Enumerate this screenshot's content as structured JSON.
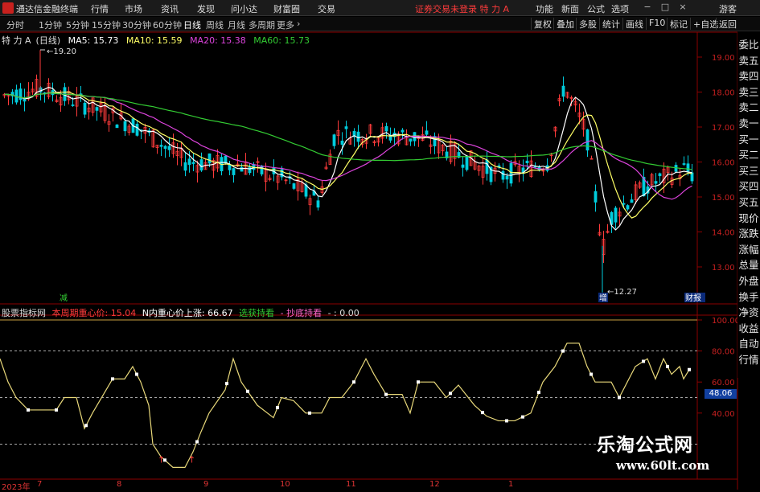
{
  "menubar": {
    "app_title": "通达信金融终端",
    "items": [
      "行情",
      "市场",
      "资讯",
      "发现",
      "问小达",
      "财富圈",
      "交易"
    ],
    "notice": "证券交易未登录  特 力 A",
    "right_items": [
      "功能",
      "新面",
      "公式",
      "选项"
    ],
    "guest": "游客"
  },
  "tabs": {
    "items": [
      "分时",
      "1分钟",
      "5分钟",
      "15分钟",
      "30分钟",
      "60分钟",
      "日线",
      "周线",
      "月线",
      "多周期",
      "更多"
    ],
    "active": "日线",
    "right_buttons": [
      "复权",
      "叠加",
      "多股",
      "统计",
      "画线",
      "F10",
      "标记",
      "+自选",
      "返回"
    ]
  },
  "main_info": {
    "stock": "特 力 A",
    "period": "(日线)",
    "ma5": "MA5: 15.73",
    "ma10": "MA10: 15.59",
    "ma20": "MA20: 15.38",
    "ma60": "MA60: 15.73"
  },
  "price_axis": {
    "ticks": [
      "19.00",
      "18.00",
      "17.00",
      "16.00",
      "15.00",
      "14.00",
      "13.00"
    ]
  },
  "annotations": {
    "high": "19.20",
    "low": "12.27",
    "left_tag": "减",
    "low_tag": "增",
    "right_tag": "财报"
  },
  "indicator_info": {
    "name": "股票指标网",
    "line1": "本周期重心价: 15.04",
    "line2": "N内重心价上涨: 66.67",
    "line3": "选获持看",
    "line4": "- 抄底持看",
    "line5": "- : 0.00"
  },
  "indicator_axis": {
    "ticks": [
      "100.00",
      "80.00",
      "60.00",
      "40.00"
    ],
    "current": "48.06"
  },
  "sidebar": [
    "委比",
    "卖五",
    "卖四",
    "卖三",
    "卖二",
    "卖一",
    "买一",
    "买二",
    "买三",
    "买四",
    "买五",
    "现价",
    "涨跌",
    "涨幅",
    "总量",
    "外盘",
    "换手",
    "净资",
    "收益",
    "自动",
    "行情"
  ],
  "xaxis": [
    "2023年",
    "7",
    "8",
    "9",
    "10",
    "11",
    "12",
    "1"
  ],
  "watermark": {
    "line1": "乐淘公式网",
    "line2": "www.60lt.com"
  },
  "colors": {
    "up": "#ff3b3b",
    "down": "#00ccdd",
    "ma5": "#ffffff",
    "ma10": "#ffff66",
    "ma20": "#dd44dd",
    "ma60": "#33cc33",
    "indicator": "#e8d87a"
  }
}
